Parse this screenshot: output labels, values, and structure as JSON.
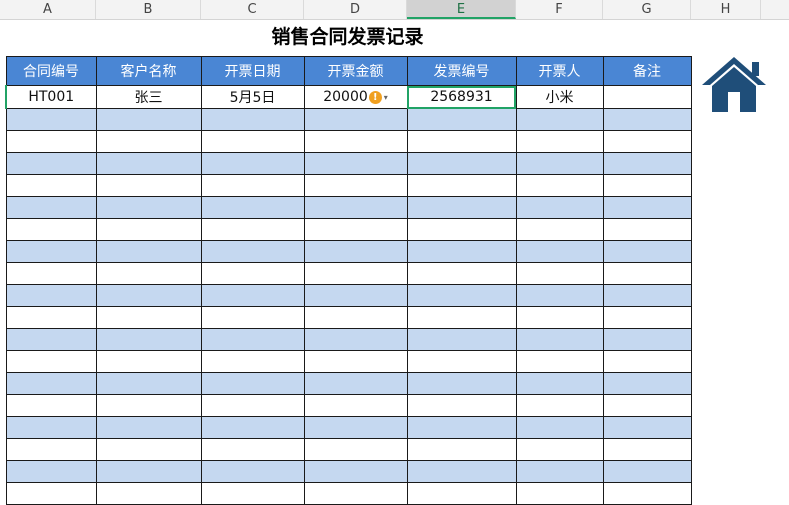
{
  "columns": [
    "A",
    "B",
    "C",
    "D",
    "E",
    "F",
    "G",
    "H"
  ],
  "title": "销售合同发票记录",
  "headers": [
    "合同编号",
    "客户名称",
    "开票日期",
    "开票金额",
    "发票编号",
    "开票人",
    "备注"
  ],
  "row1": {
    "contract_no": "HT001",
    "customer": "张三",
    "date": "5月5日",
    "amount": "20000",
    "invoice_no": "2568931",
    "issuer": "小米",
    "note": ""
  },
  "warning_icon": "!",
  "dropdown_icon": "▾",
  "colors": {
    "header_blue": "#4a86d4",
    "band_blue": "#c5d8f0",
    "select_green": "#21a366",
    "home_icon": "#1f4e79"
  }
}
